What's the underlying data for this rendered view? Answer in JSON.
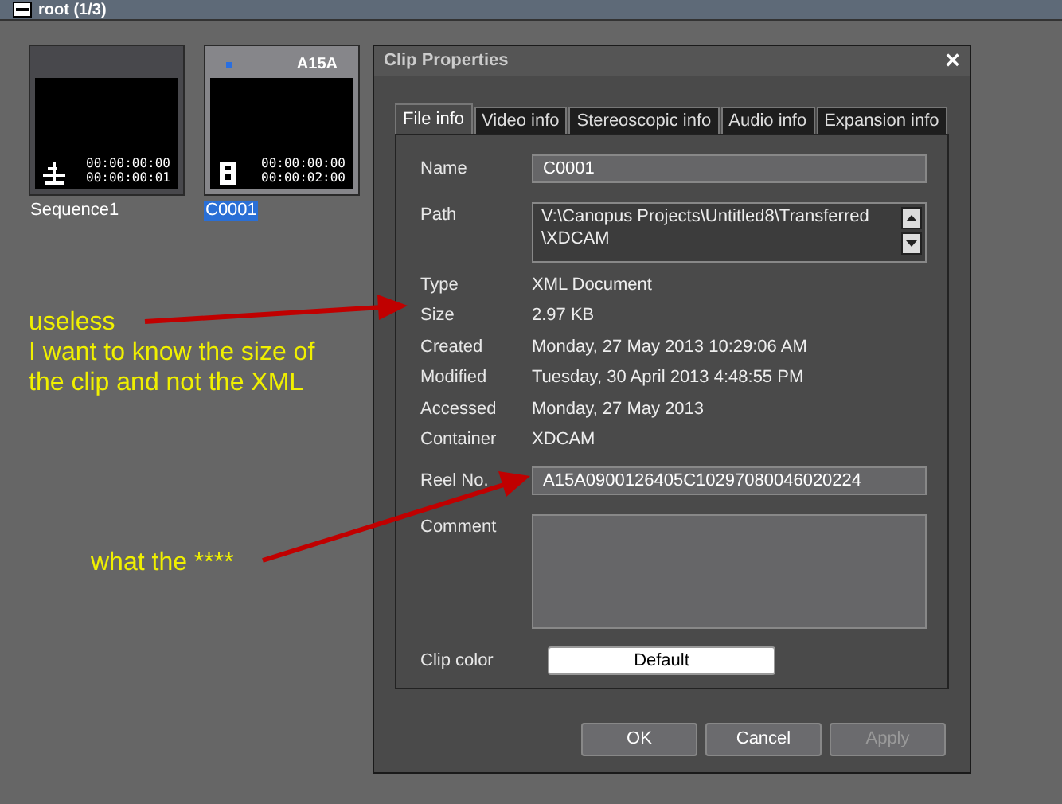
{
  "bin": {
    "title": "root (1/3)"
  },
  "clips": [
    {
      "kind": "sequence",
      "name": "Sequence1",
      "timecode_in": "00:00:00:00",
      "timecode_out": "00:00:00:01",
      "flagged": false,
      "selected": false
    },
    {
      "kind": "clip",
      "name": "C0001",
      "reel": "A15A",
      "timecode_in": "00:00:00:00",
      "timecode_out": "00:00:02:00",
      "flagged": true,
      "selected": true
    }
  ],
  "dialog": {
    "title": "Clip Properties",
    "close": "×",
    "tabs": [
      {
        "label": "File info",
        "selected": true
      },
      {
        "label": "Video info",
        "selected": false
      },
      {
        "label": "Stereoscopic info",
        "selected": false
      },
      {
        "label": "Audio info",
        "selected": false
      },
      {
        "label": "Expansion info",
        "selected": false
      }
    ],
    "fields": [
      {
        "kind": "input",
        "label": "Name",
        "value": "C0001"
      },
      {
        "kind": "path",
        "label": "Path",
        "value": "V:\\Canopus Projects\\Untitled8\\Transferred \\XDCAM"
      },
      {
        "kind": "text",
        "label": "Type",
        "value": "XML Document"
      },
      {
        "kind": "text",
        "label": "Size",
        "value": "2.97 KB"
      },
      {
        "kind": "text",
        "label": "Created",
        "value": "Monday, 27 May 2013 10:29:06 AM"
      },
      {
        "kind": "text",
        "label": "Modified",
        "value": "Tuesday, 30 April 2013 4:48:55 PM"
      },
      {
        "kind": "text",
        "label": "Accessed",
        "value": "Monday, 27 May 2013"
      },
      {
        "kind": "text",
        "label": "Container",
        "value": "XDCAM"
      },
      {
        "kind": "input",
        "label": "Reel No.",
        "value": "A15A0900126405C10297080046020224"
      },
      {
        "kind": "textarea",
        "label": "Comment"
      },
      {
        "kind": "color",
        "label": "Clip color",
        "value": "Default"
      }
    ],
    "buttons": [
      {
        "label": "OK",
        "disabled": false
      },
      {
        "label": "Cancel",
        "disabled": false
      },
      {
        "label": "Apply",
        "disabled": true
      }
    ]
  },
  "annotations": [
    {
      "lines": [
        "useless",
        "I want to know the size of",
        "the clip and not the XML"
      ]
    },
    {
      "lines": [
        "what the ****"
      ]
    }
  ]
}
